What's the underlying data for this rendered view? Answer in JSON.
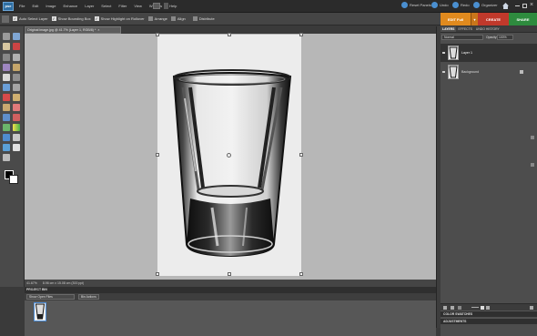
{
  "app": {
    "logo_text": "pse",
    "menu": [
      "File",
      "Edit",
      "Image",
      "Enhance",
      "Layer",
      "Select",
      "Filter",
      "View",
      "Window",
      "Help"
    ],
    "top_right": [
      {
        "label": "Reset Panels",
        "color": "#4a8fd0"
      },
      {
        "label": "Undo",
        "color": "#4a8fd0"
      },
      {
        "label": "Redo",
        "color": "#4a8fd0"
      },
      {
        "label": "Organizer",
        "color": "#4a8fd0"
      }
    ]
  },
  "options_bar": {
    "auto_select": "Auto Select Layer",
    "bounding_box": "Show Bounding Box",
    "highlight": "Show Highlight on Rollover",
    "arrange": "Arrange",
    "align": "Align",
    "distribute": "Distribute"
  },
  "mode_tabs": [
    {
      "label": "EDIT Full",
      "color": "#e08a1e"
    },
    {
      "label": "CREATE",
      "color": "#c0392b"
    },
    {
      "label": "SHARE",
      "color": "#2e8b3e"
    }
  ],
  "document": {
    "tab_title": "Original image.jpg @ 41.7% (Layer 1, RGB/8) *",
    "zoom": "41.67%",
    "doc_info": "8.96 cm x 15.08 cm (300 ppi)"
  },
  "layers_panel": {
    "tabs": [
      "LAYERS",
      "EFFECTS",
      "UNDO HISTORY"
    ],
    "blend_mode": "Normal",
    "opacity_label": "Opacity:",
    "opacity_value": "100%",
    "layers": [
      {
        "name": "Layer 1"
      },
      {
        "name": "Background"
      }
    ]
  },
  "panel_sections": [
    "COLOR SWATCHES",
    "ADJUSTMENTS"
  ],
  "project_bin": {
    "title": "PROJECT BIN",
    "show_label": "Show Open Files",
    "bin_actions": "Bin Actions"
  }
}
